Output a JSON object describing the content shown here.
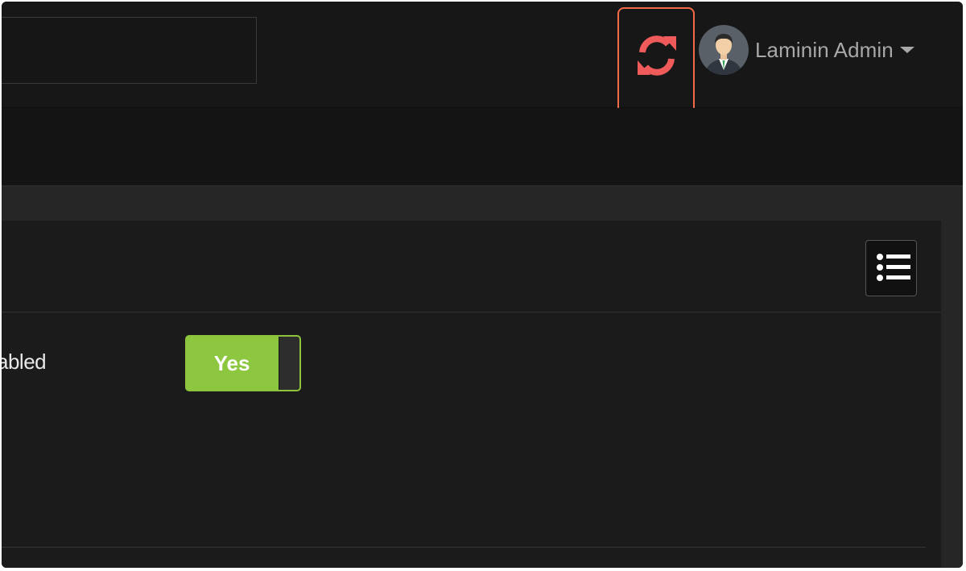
{
  "header": {
    "search": {
      "value": "",
      "placeholder": ""
    },
    "refresh_icon": "refresh-icon",
    "user": {
      "name": "Laminin Admin",
      "avatar_icon": "user-avatar-icon",
      "caret_icon": "caret-down-icon"
    }
  },
  "panel": {
    "list_icon": "list-icon",
    "field": {
      "label": "abled",
      "toggle_label": "Yes",
      "toggle_state": true
    }
  },
  "colors": {
    "highlight": "#f26b46",
    "refresh": "#ef5b5b",
    "toggle_on": "#8dc63f"
  }
}
